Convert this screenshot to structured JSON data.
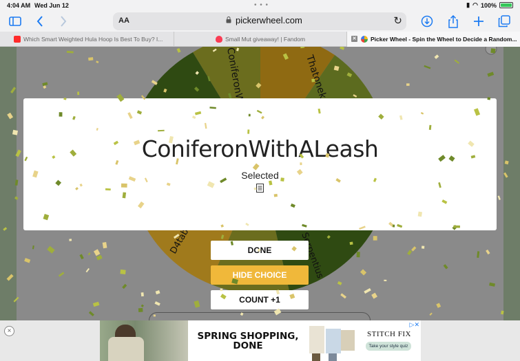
{
  "status_bar": {
    "time": "4:04 AM",
    "date": "Wed Jun 12",
    "battery": "100%"
  },
  "toolbar": {
    "text_size_label": "AA",
    "url": "pickerwheel.com"
  },
  "tabs": [
    {
      "title": "Which Smart Weighted Hula Hoop Is Best To Buy? I...",
      "active": false
    },
    {
      "title": "Small Mut giveaway! | Fandom",
      "active": false
    },
    {
      "title": "Picker Wheel - Spin the Wheel to Decide a Random...",
      "active": true
    }
  ],
  "wheel": {
    "segment_labels": [
      "ConiferonW",
      "Thatoneko",
      "D4tab",
      "Serpentius"
    ],
    "colors": [
      "#2f4a12",
      "#6b6d1e",
      "#8f6a12",
      "#a07a1c",
      "#5c6b1f"
    ]
  },
  "result_modal": {
    "result": "ConiferonWithALeash",
    "status": "Selected"
  },
  "buttons": {
    "done": "DONE",
    "hide_choice": "HIDE CHOICE",
    "count": "COUNT +1"
  },
  "ad": {
    "headline": "SPRING SHOPPING, DONE",
    "brand": "STITCH FIX",
    "cta": "Take your style quiz",
    "close": "×"
  },
  "colors": {
    "accent_blue": "#1c7bf2",
    "hide_button": "#f0b83a"
  }
}
